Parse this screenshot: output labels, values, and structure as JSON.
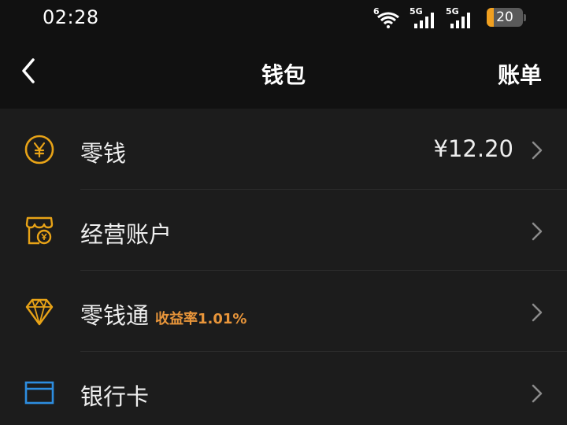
{
  "status_bar": {
    "time": "02:28",
    "wifi_tag": "6",
    "sim1_tag": "5G",
    "sim2_tag": "5G",
    "battery": "20",
    "battery_level": 0.2
  },
  "nav": {
    "back_icon": "chevron-left-icon",
    "title": "钱包",
    "right_label": "账单"
  },
  "items": [
    {
      "icon": "yuan-coin-icon",
      "label": "零钱",
      "sub": "",
      "value": "¥12.20"
    },
    {
      "icon": "store-account-icon",
      "label": "经营账户",
      "sub": "",
      "value": ""
    },
    {
      "icon": "diamond-icon",
      "label": "零钱通",
      "sub": "收益率1.01%",
      "value": ""
    },
    {
      "icon": "bank-card-icon",
      "label": "银行卡",
      "sub": "",
      "value": ""
    }
  ],
  "colors": {
    "accent_gold": "#e8a317",
    "accent_orange": "#e8953a",
    "card_blue": "#2d8de0",
    "background": "#1c1c1c",
    "bar_background": "#111111"
  }
}
